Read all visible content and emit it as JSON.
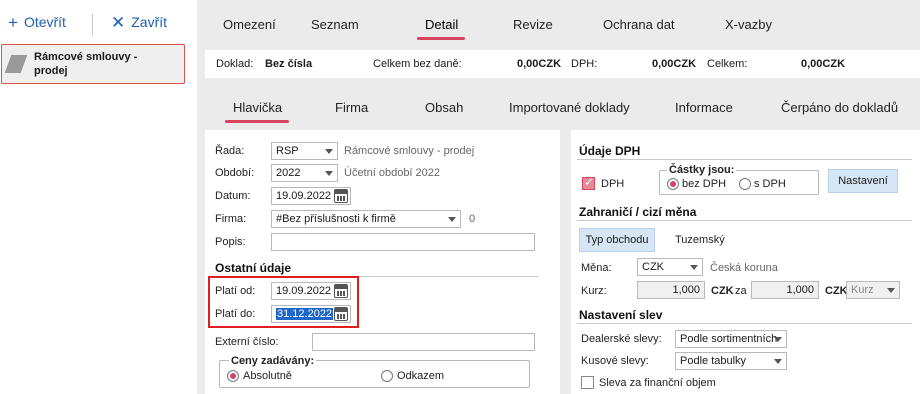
{
  "toolbar": {
    "open_label": "Otevřít",
    "close_label": "Zavřít"
  },
  "doc_list": {
    "item_label": "Rámcové smlouvy - prodej"
  },
  "top_tabs": [
    "Omezení",
    "Seznam",
    "Detail",
    "Revize",
    "Ochrana dat",
    "X-vazby"
  ],
  "summary": {
    "doklad_label": "Doklad:",
    "doklad_value": "Bez čísla",
    "bez_dane_label": "Celkem bez daně:",
    "bez_dane_value": "0,00CZK",
    "dph_label": "DPH:",
    "dph_value": "0,00CZK",
    "celkem_label": "Celkem:",
    "celkem_value": "0,00CZK"
  },
  "sub_tabs": [
    "Hlavička",
    "Firma",
    "Obsah",
    "Importované doklady",
    "Informace",
    "Čerpáno do dokladů"
  ],
  "form": {
    "rada_label": "Řada:",
    "rada_value": "RSP",
    "rada_desc": "Rámcové smlouvy - prodej",
    "obdobi_label": "Období:",
    "obdobi_value": "2022",
    "obdobi_desc": "Účetní období 2022",
    "datum_label": "Datum:",
    "datum_value": "19.09.2022",
    "firma_label": "Firma:",
    "firma_value": "#Bez příslušnosti k firmě",
    "firma_count": "0",
    "popis_label": "Popis:",
    "popis_value": ""
  },
  "ostatni": {
    "title": "Ostatní údaje",
    "plati_od_label": "Platí od:",
    "plati_od_value": "19.09.2022",
    "plati_do_label": "Platí do:",
    "plati_do_value": "31.12.2022",
    "externi_label": "Externí číslo:",
    "externi_value": "",
    "ceny_title": "Ceny zadávány:",
    "absolutne": "Absolutně",
    "odkazem": "Odkazem"
  },
  "dph": {
    "title": "Údaje DPH",
    "dph_check_label": "DPH",
    "castky_title": "Částky jsou:",
    "bez_dph": "bez DPH",
    "s_dph": "s DPH",
    "nastaveni_button": "Nastavení"
  },
  "zahranici": {
    "title": "Zahraničí / cizí měna",
    "typ_obchodu_button": "Typ obchodu",
    "tuzemsky": "Tuzemský",
    "mena_label": "Měna:",
    "mena_value": "CZK",
    "mena_desc": "Česká koruna",
    "kurz_label": "Kurz:",
    "kurz_value1": "1,000",
    "kurz_cur1": "CZK",
    "kurz_za": "za",
    "kurz_value2": "1,000",
    "kurz_cur2": "CZK",
    "kurz_select": "Kurz"
  },
  "slevy": {
    "title": "Nastavení slev",
    "dealerske_label": "Dealerské slevy:",
    "dealerske_value": "Podle sortimentních",
    "kusove_label": "Kusové slevy:",
    "kusove_value": "Podle tabulky",
    "financni_label": "Sleva za finanční objem"
  }
}
